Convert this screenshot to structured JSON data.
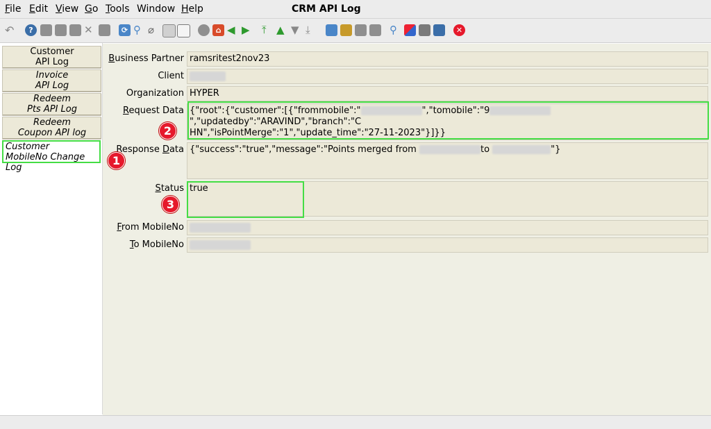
{
  "window": {
    "title": "CRM API Log"
  },
  "menu": [
    {
      "label": "File",
      "ul": "F",
      "rest": "ile"
    },
    {
      "label": "Edit",
      "ul": "E",
      "rest": "dit"
    },
    {
      "label": "View",
      "ul": "V",
      "rest": "iew"
    },
    {
      "label": "Go",
      "ul": "G",
      "rest": "o"
    },
    {
      "label": "Tools",
      "ul": "T",
      "rest": "ools"
    },
    {
      "label": "Window",
      "ul": "",
      "rest": "Window"
    },
    {
      "label": "Help",
      "ul": "H",
      "rest": "elp"
    }
  ],
  "toolbar_icons": [
    "undo-icon",
    "help-icon",
    "new-icon",
    "copy-icon",
    "delete-icon",
    "delete-selection-icon",
    "save-icon",
    "refresh-icon",
    "find-icon",
    "attachment-icon",
    "chat-icon",
    "grid-toggle-icon",
    "history-icon",
    "home-icon",
    "back-icon",
    "forward-icon",
    "first-record-icon",
    "previous-record-icon",
    "next-record-icon",
    "last-record-icon",
    "report-icon",
    "archive-icon",
    "print-preview-icon",
    "print-icon",
    "zoom-across-icon",
    "active-workflows-icon",
    "product-info-icon",
    "end-icon",
    "close-icon"
  ],
  "tabs": [
    {
      "line1": "Customer",
      "line2": "API Log"
    },
    {
      "line1": "Invoice",
      "line2": "API Log"
    },
    {
      "line1": "Redeem",
      "line2": "Pts API Log"
    },
    {
      "line1": "Redeem",
      "line2": "Coupon API log"
    },
    {
      "line1": "Customer",
      "line2": "MobileNo Change Log"
    }
  ],
  "fields": {
    "business_partner": {
      "label_ul": "B",
      "label_rest": "usiness Partner",
      "value": "ramsritest2nov23"
    },
    "client": {
      "label": "Client",
      "value": ""
    },
    "organization": {
      "label": "Organization",
      "value": "HYPER"
    },
    "request_data": {
      "label_ul": "R",
      "label_rest": "equest Data",
      "line1_a": "{\"root\":{\"customer\":[{\"frommobile\":\"",
      "line1_b": "\",\"tomobile\":\"9",
      "line1_c": "\",\"updatedby\":\"ARAVIND\",\"branch\":\"C",
      "line2": "HN\",\"isPointMerge\":\"1\",\"update_time\":\"27-11-2023\"}]}}"
    },
    "response_data": {
      "label": "Response",
      "label_ul": "D",
      "label_rest": "ata",
      "value_a": "{\"success\":\"true\",\"message\":\"Points merged from ",
      "value_b": "to ",
      "value_c": "\"}"
    },
    "status": {
      "label_ul": "S",
      "label_rest": "tatus",
      "value": "true"
    },
    "from_mobile": {
      "label_ul": "F",
      "label_rest": "rom MobileNo",
      "value": ""
    },
    "to_mobile": {
      "label_ul": "T",
      "label_rest": "o MobileNo",
      "value": ""
    }
  },
  "badges": {
    "one": "1",
    "two": "2",
    "three": "3"
  },
  "colors": {
    "highlight": "#44dd44",
    "badge": "#e6192b",
    "field_bg": "#ece9d8"
  }
}
